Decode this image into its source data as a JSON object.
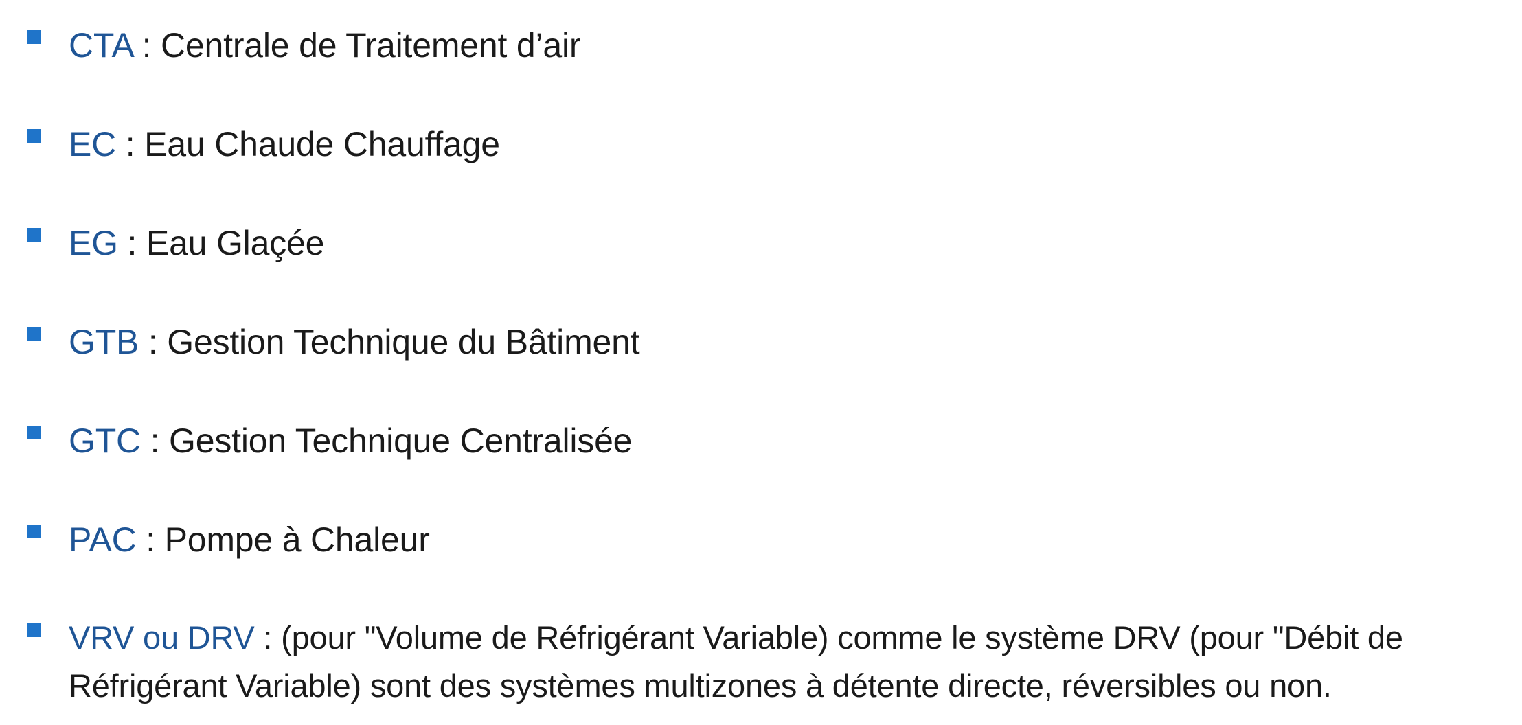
{
  "glossary": {
    "items": [
      {
        "abbr": "CTA",
        "sep": " : ",
        "def": "Centrale de Traitement d’air"
      },
      {
        "abbr": "EC",
        "sep": " : ",
        "def": "Eau Chaude Chauffage"
      },
      {
        "abbr": "EG",
        "sep": " : ",
        "def": "Eau Glaçée"
      },
      {
        "abbr": "GTB",
        "sep": " : ",
        "def": "Gestion Technique du Bâtiment"
      },
      {
        "abbr": "GTC",
        "sep": " : ",
        "def": "Gestion Technique Centralisée"
      },
      {
        "abbr": "PAC",
        "sep": " : ",
        "def": "Pompe à Chaleur"
      },
      {
        "abbr": "VRV ou DRV",
        "sep": " : ",
        "def": "(pour \"Volume de Réfrigérant Variable) comme le système DRV (pour \"Débit de Réfrigérant Variable) sont des systèmes multizones à détente directe, réversibles ou non."
      }
    ]
  },
  "colors": {
    "bullet": "#1f74c9",
    "abbreviation": "#1f5596",
    "text": "#1a1a1a"
  }
}
